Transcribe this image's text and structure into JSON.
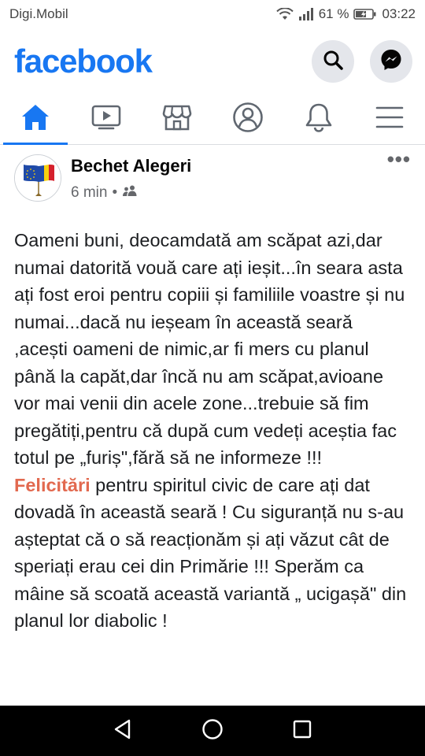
{
  "status": {
    "carrier": "Digi.Mobil",
    "battery_pct": "61 %",
    "time": "03:22"
  },
  "header": {
    "logo_text": "facebook",
    "brand_color": "#1877f2"
  },
  "nav": {
    "tabs": [
      {
        "icon": "home-icon",
        "active": true
      },
      {
        "icon": "watch-icon",
        "active": false
      },
      {
        "icon": "marketplace-icon",
        "active": false
      },
      {
        "icon": "profile-icon",
        "active": false
      },
      {
        "icon": "bell-icon",
        "active": false
      },
      {
        "icon": "menu-icon",
        "active": false
      }
    ]
  },
  "post": {
    "author": "Bechet Alegeri",
    "time": "6 min",
    "separator": "•",
    "text_part1": "Oameni buni, deocamdată am scăpat azi,dar numai datorită vouă care ați ieșit...în seara asta ați fost eroi pentru copiii și familiile voastre și nu numai...dacă nu ieșeam în această seară ,acești oameni de nimic,ar fi mers cu planul până la capăt,dar încă nu am scăpat,avioane vor mai venii din acele zone...trebuie să fim pregătiți,pentru că după cum vedeți aceștia fac totul pe „furiș\",fără să ne informeze !!!",
    "highlight": "Felicitări",
    "text_part2": " pentru spiritul civic de care ați dat dovadă în această seară ! Cu siguranță nu s-au așteptat că o să reacționăm și ați văzut cât de speriați erau cei din Primărie !!! Sperăm ca mâine să scoată această variantă „ ucigașă\" din planul lor diabolic !",
    "highlight_color": "#e2694f"
  }
}
